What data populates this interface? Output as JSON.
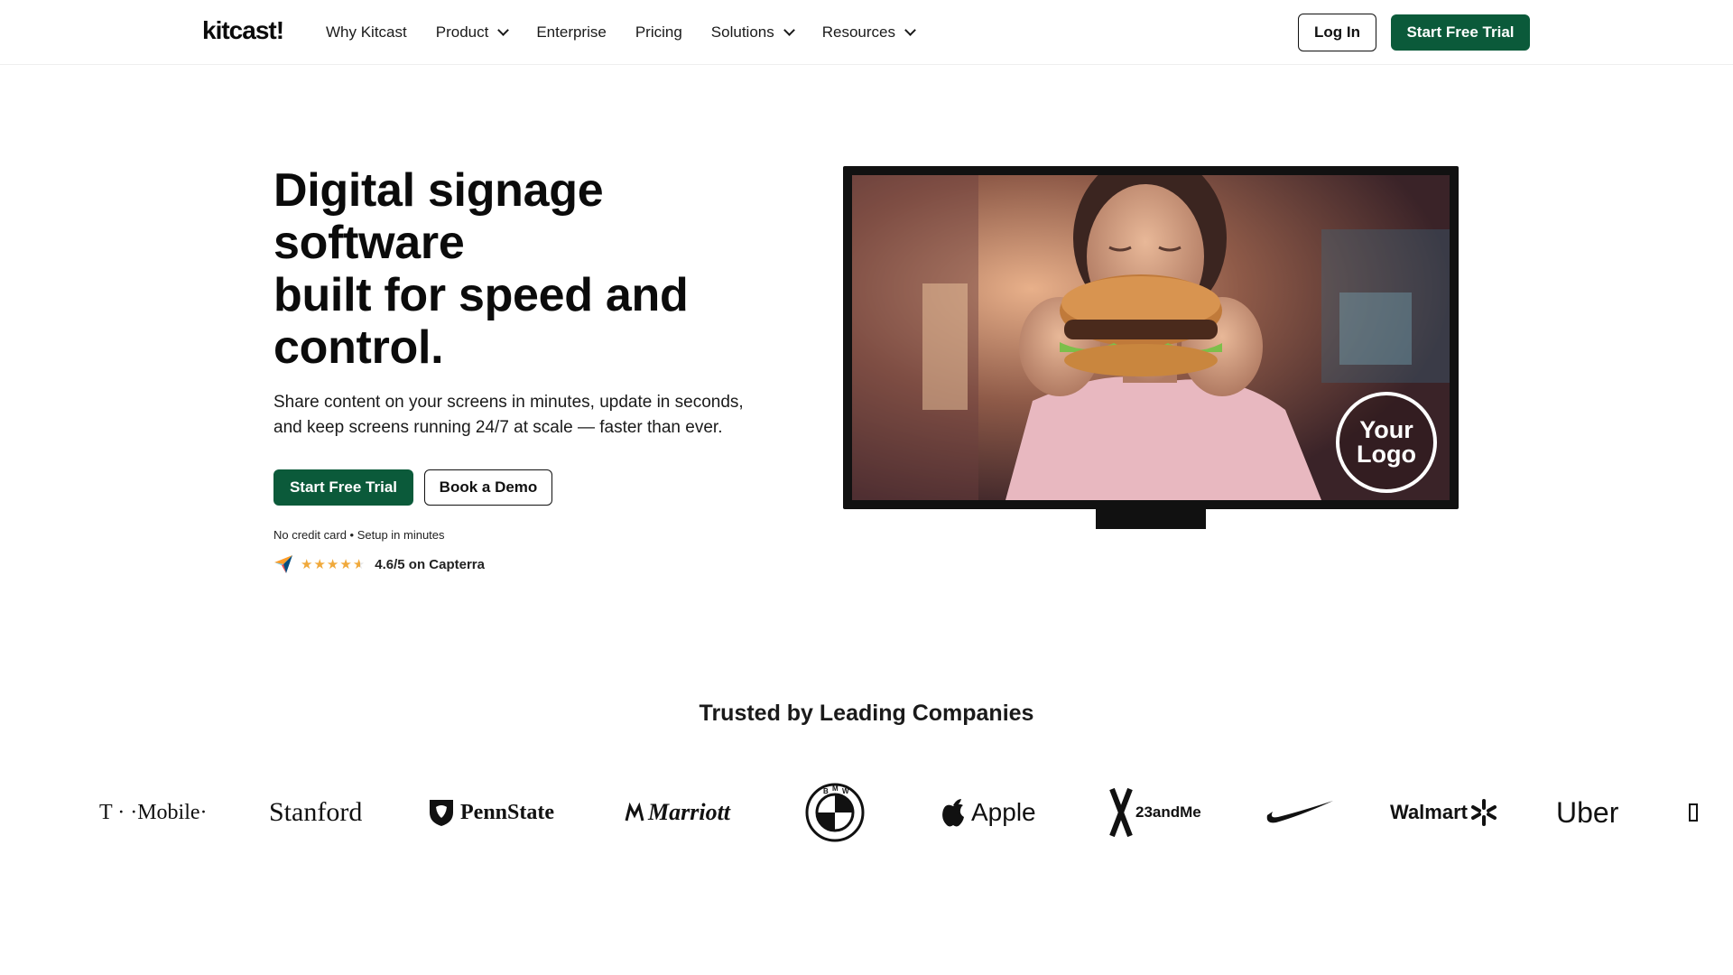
{
  "header": {
    "logo": "kitcast!",
    "nav": [
      {
        "label": "Why Kitcast",
        "has_dropdown": false
      },
      {
        "label": "Product",
        "has_dropdown": true
      },
      {
        "label": "Enterprise",
        "has_dropdown": false
      },
      {
        "label": "Pricing",
        "has_dropdown": false
      },
      {
        "label": "Solutions",
        "has_dropdown": true
      },
      {
        "label": "Resources",
        "has_dropdown": true
      }
    ],
    "login_label": "Log In",
    "trial_label": "Start Free Trial"
  },
  "hero": {
    "title_lines": [
      "Digital signage",
      "software",
      "built for speed and",
      "control."
    ],
    "subtitle_lines": [
      "Share content on your screens in minutes, update in seconds,",
      "and keep screens running 24/7 at scale — faster than ever."
    ],
    "primary_cta": "Start Free Trial",
    "secondary_cta": "Book a Demo",
    "note": "No credit card • Setup in minutes",
    "rating_text": "4.6/5 on Capterra",
    "rating_value": 4.6,
    "rating_max": 5,
    "media_overlay": [
      "Your",
      "Logo"
    ]
  },
  "trusted": {
    "heading": "Trusted by Leading Companies",
    "brands": [
      "T · ·Mobile·",
      "Stanford",
      "PennState",
      "Marriott",
      "BMW",
      "Apple",
      "23andMe",
      "Nike",
      "Walmart",
      "Uber"
    ]
  },
  "colors": {
    "brand_green": "#0b5a3a",
    "star_orange": "#f0a93b",
    "text": "#0b0b0b"
  }
}
